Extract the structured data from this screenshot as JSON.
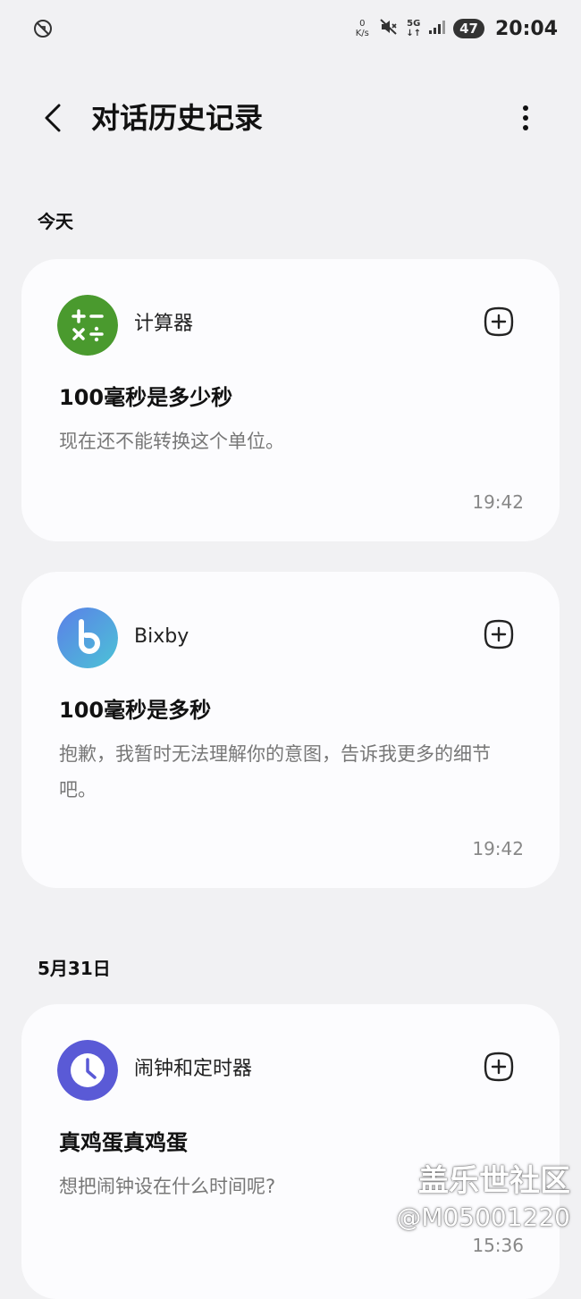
{
  "status_bar": {
    "net_speed_value": "0",
    "net_speed_unit": "K/s",
    "network": "5G",
    "battery": "47",
    "time": "20:04"
  },
  "header": {
    "title": "对话历史记录"
  },
  "sections": [
    {
      "label": "今天",
      "cards": [
        {
          "app": "计算器",
          "icon": "calculator-icon",
          "query": "100毫秒是多少秒",
          "reply": "现在还不能转换这个单位。",
          "time": "19:42",
          "color": "#4a9a2e"
        },
        {
          "app": "Bixby",
          "icon": "bixby-icon",
          "query": "100毫秒是多秒",
          "reply": "抱歉，我暂时无法理解你的意图，告诉我更多的细节吧。",
          "time": "19:42",
          "color": "#4f8fe0"
        }
      ]
    },
    {
      "label": "5月31日",
      "cards": [
        {
          "app": "闹钟和定时器",
          "icon": "alarm-clock-icon",
          "query": "真鸡蛋真鸡蛋",
          "reply": "想把闹钟设在什么时间呢?",
          "time": "15:36",
          "color": "#5a5ad6"
        }
      ]
    }
  ],
  "watermark": {
    "main": "盖乐世社区",
    "sub": "@M05001220"
  }
}
